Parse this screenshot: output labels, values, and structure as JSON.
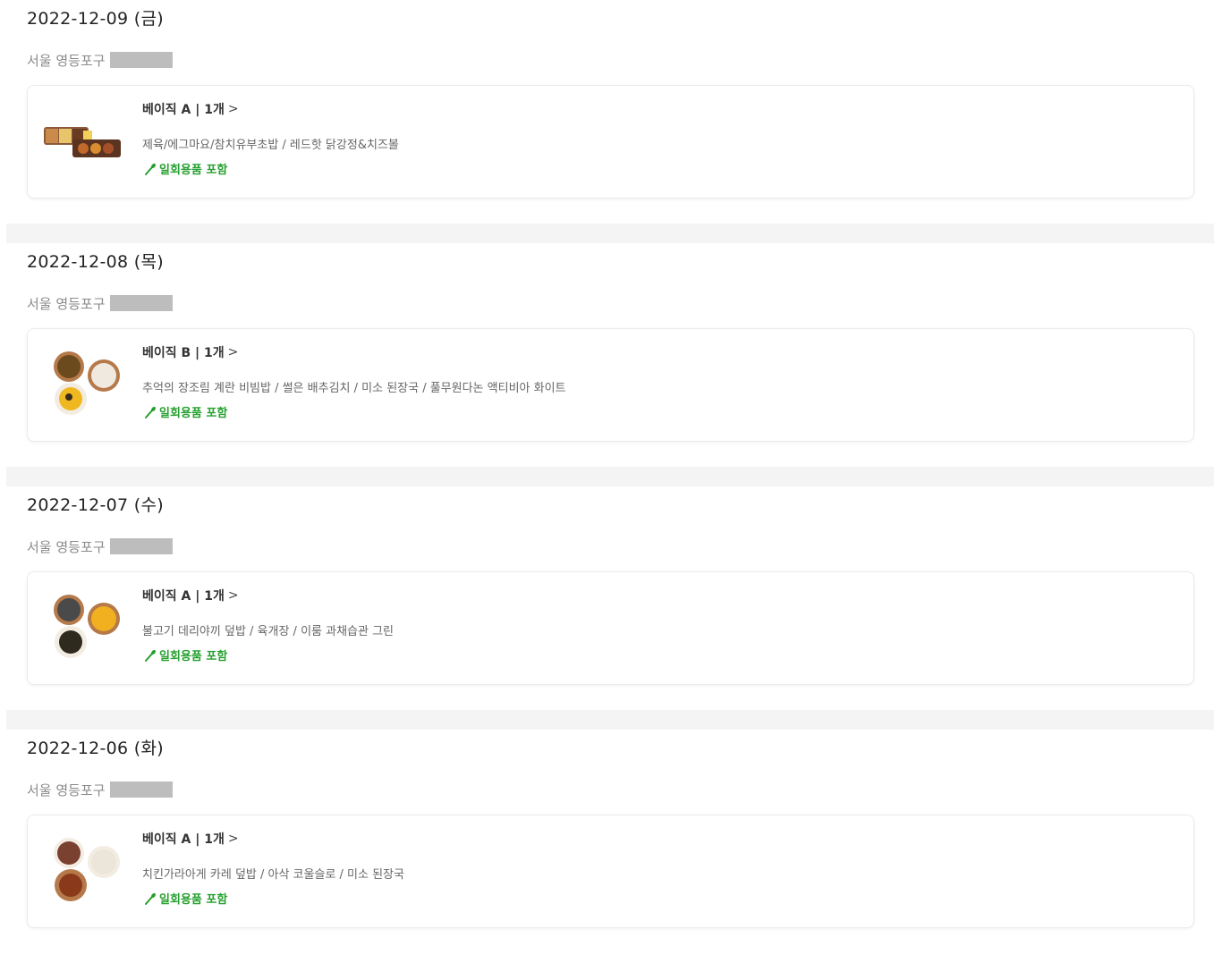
{
  "orders": [
    {
      "date": "2022-12-09 (금)",
      "address": "서울 영등포구",
      "product": "베이직 A | 1개",
      "items": "제육/에그마요/참치유부초밥 / 레드핫 닭강정&치즈볼",
      "extra": "일회용품 포함"
    },
    {
      "date": "2022-12-08 (목)",
      "address": "서울 영등포구",
      "product": "베이직 B | 1개",
      "items": "추억의 장조림 계란 비빔밥 / 썰은 배추김치 / 미소 된장국 / 풀무원다논 액티비아 화이트",
      "extra": "일회용품 포함"
    },
    {
      "date": "2022-12-07 (수)",
      "address": "서울 영등포구",
      "product": "베이직 A | 1개",
      "items": "불고기 데리야끼 덮밥 / 육개장 / 이룸 과채습관 그린",
      "extra": "일회용품 포함"
    },
    {
      "date": "2022-12-06 (화)",
      "address": "서울 영등포구",
      "product": "베이직 A | 1개",
      "items": "치킨가라아게 카레 덮밥 / 아삭 코울슬로 / 미소 된장국",
      "extra": "일회용품 포함"
    }
  ],
  "icons": {
    "chevron": "chevron-right-icon",
    "utensil": "utensil-icon"
  },
  "colors": {
    "accent_green": "#27a030",
    "divider": "#f4f4f4"
  }
}
